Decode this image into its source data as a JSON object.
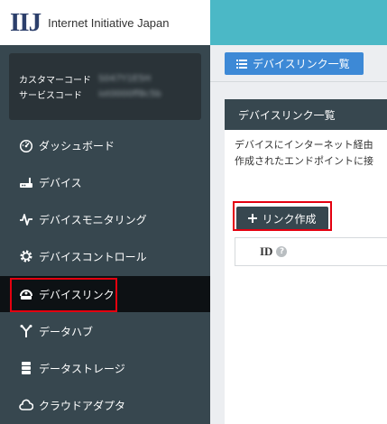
{
  "header": {
    "logo_mark": "IIJ",
    "company_name": "Internet Initiative Japan"
  },
  "account": {
    "customer_code_label": "カスタマーコード",
    "customer_code_value": "S047Y1E5H",
    "service_code_label": "サービスコード",
    "service_code_value": "iot0000ff8c5b"
  },
  "sidebar": {
    "items": [
      {
        "label": "ダッシュボード",
        "icon": "dashboard-icon"
      },
      {
        "label": "デバイス",
        "icon": "router-icon"
      },
      {
        "label": "デバイスモニタリング",
        "icon": "pulse-icon"
      },
      {
        "label": "デバイスコントロール",
        "icon": "gear-icon"
      },
      {
        "label": "デバイスリンク",
        "icon": "device-link-icon",
        "active": true
      },
      {
        "label": "データハブ",
        "icon": "fork-icon"
      },
      {
        "label": "データストレージ",
        "icon": "database-icon"
      },
      {
        "label": "クラウドアダプタ",
        "icon": "cloud-icon"
      }
    ]
  },
  "content": {
    "breadcrumb_label": "デバイスリンク一覧",
    "panel_title": "デバイスリンク一覧",
    "description_line1": "デバイスにインターネット経由",
    "description_line2": "作成されたエンドポイントに接",
    "create_button_label": "リンク作成",
    "table_header_id": "ID",
    "help_glyph": "?"
  },
  "colors": {
    "accent_teal": "#4bb8c6",
    "sidebar_bg": "#37474f",
    "active_bg": "#0d1114",
    "primary_blue": "#3d89d6",
    "highlight_red": "#e4000f"
  }
}
